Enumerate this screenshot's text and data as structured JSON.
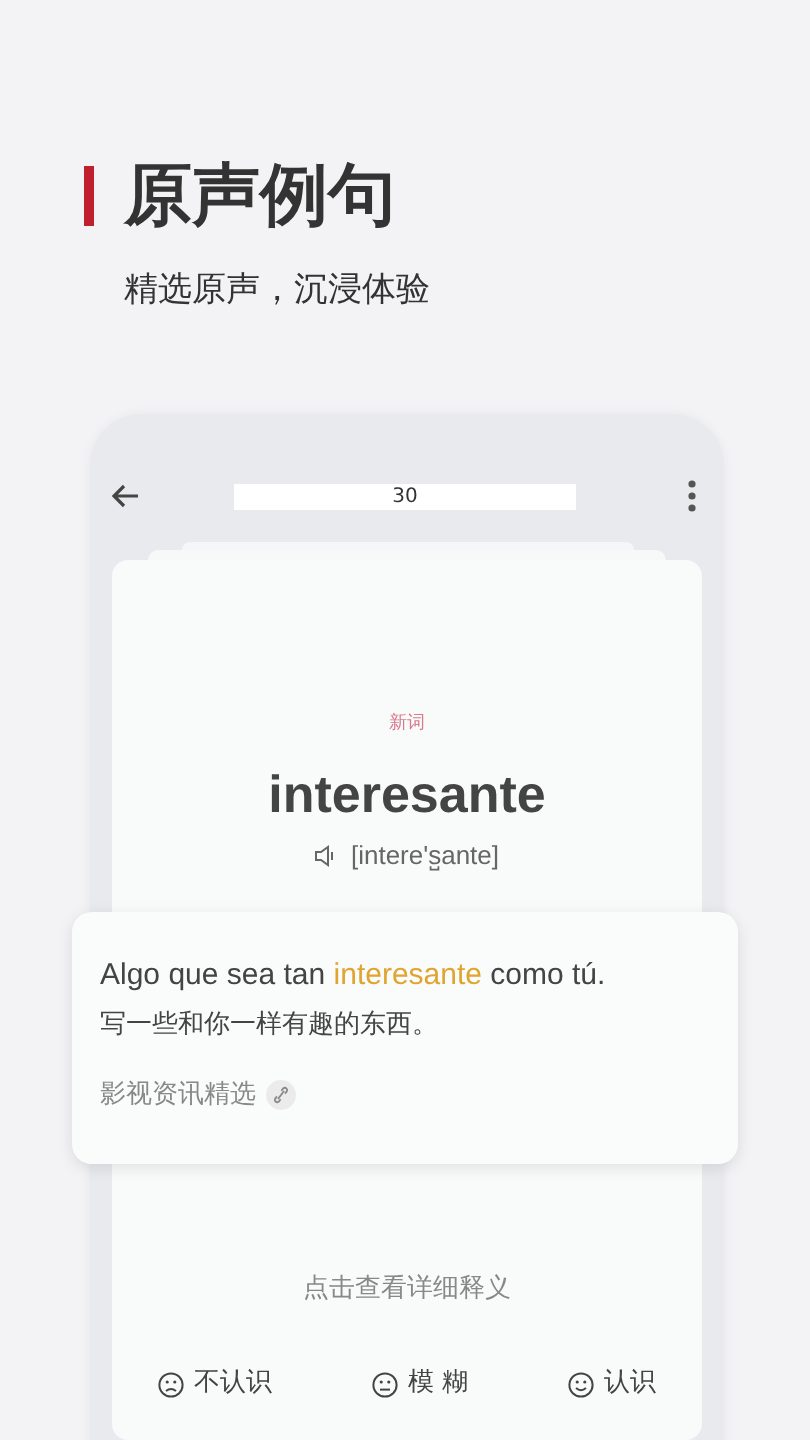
{
  "header": {
    "title": "原声例句",
    "subtitle": "精选原声，沉浸体验"
  },
  "toolbar": {
    "progress": "30"
  },
  "card": {
    "tag": "新词",
    "word": "interesante",
    "phonetic": "[intere's̺ante]",
    "hint": "点击查看详细释义"
  },
  "example": {
    "sentence": [
      {
        "text": "Algo que sea tan ",
        "highlight": false
      },
      {
        "text": "interesante",
        "highlight": true
      },
      {
        "text": " como tú.",
        "highlight": false
      }
    ],
    "translation": "写一些和你一样有趣的东西。",
    "source": "影视资讯精选"
  },
  "buttons": [
    {
      "label": "不认识",
      "kind": "sad"
    },
    {
      "label": "模 糊",
      "kind": "neutral"
    },
    {
      "label": "认识",
      "kind": "happy"
    }
  ]
}
